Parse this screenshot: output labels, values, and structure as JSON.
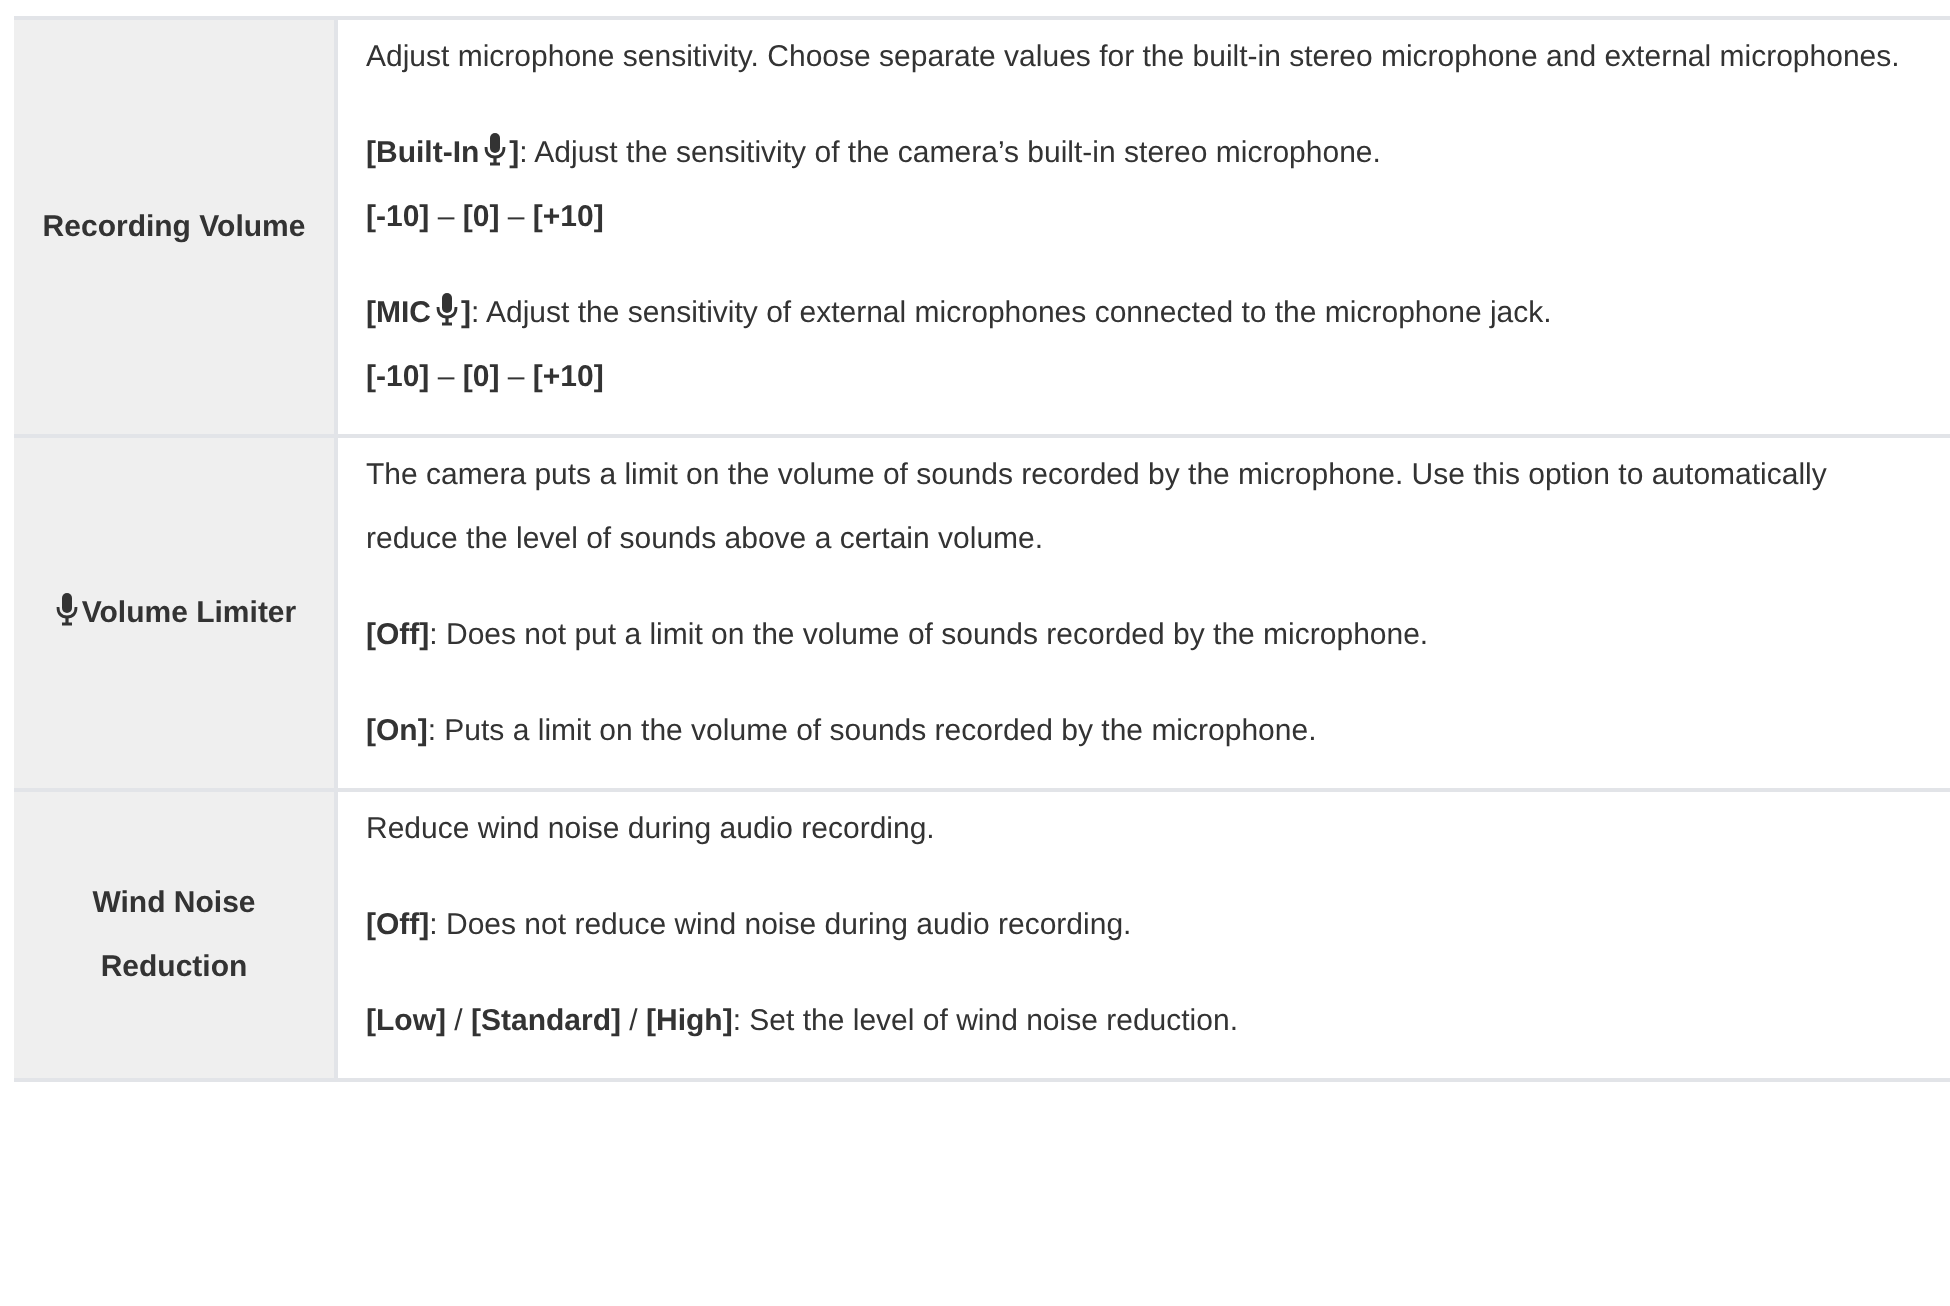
{
  "rows": [
    {
      "label": [
        {
          "kind": "text",
          "text": "Recording Volume"
        }
      ],
      "paragraphs": [
        {
          "kind": "para",
          "parts": [
            {
              "kind": "text",
              "text": "Adjust microphone sensitivity. Choose separate values for the built-in stereo microphone and external microphones."
            }
          ]
        },
        {
          "kind": "para",
          "parts": [
            {
              "kind": "text",
              "text": "**[Built-In**"
            },
            {
              "kind": "icon"
            },
            {
              "kind": "text",
              "text": "**]**: Adjust the sensitivity of the camera’s built-in stereo microphone."
            }
          ]
        },
        {
          "kind": "line",
          "parts": [
            {
              "kind": "text",
              "text": "**[-10]** – **[0]** – **[+10]**"
            }
          ]
        },
        {
          "kind": "para",
          "parts": [
            {
              "kind": "text",
              "text": "**[MIC**"
            },
            {
              "kind": "icon"
            },
            {
              "kind": "text",
              "text": "**]**: Adjust the sensitivity of external microphones connected to the microphone jack."
            }
          ]
        },
        {
          "kind": "line",
          "parts": [
            {
              "kind": "text",
              "text": "**[-10]** – **[0]** – **[+10]**"
            }
          ]
        }
      ]
    },
    {
      "label": [
        {
          "kind": "icon"
        },
        {
          "kind": "text",
          "text": "Volume Limiter"
        }
      ],
      "paragraphs": [
        {
          "kind": "para",
          "parts": [
            {
              "kind": "text",
              "text": "The camera puts a limit on the volume of sounds recorded by the microphone. Use this option to automatically reduce the level of sounds above a certain volume."
            }
          ]
        },
        {
          "kind": "para",
          "parts": [
            {
              "kind": "text",
              "text": "**[Off]**: Does not put a limit on the volume of sounds recorded by the microphone."
            }
          ]
        },
        {
          "kind": "para",
          "parts": [
            {
              "kind": "text",
              "text": "**[On]**: Puts a limit on the volume of sounds recorded by the microphone."
            }
          ]
        }
      ]
    },
    {
      "label": [
        {
          "kind": "text",
          "text": "Wind Noise Reduction"
        }
      ],
      "paragraphs": [
        {
          "kind": "para",
          "parts": [
            {
              "kind": "text",
              "text": "Reduce wind noise during audio recording."
            }
          ]
        },
        {
          "kind": "para",
          "parts": [
            {
              "kind": "text",
              "text": "**[Off]**: Does not reduce wind noise during audio recording."
            }
          ]
        },
        {
          "kind": "para",
          "parts": [
            {
              "kind": "text",
              "text": "**[Low]** / **[Standard]** / **[High]**: Set the level of wind noise reduction."
            }
          ]
        }
      ]
    }
  ]
}
